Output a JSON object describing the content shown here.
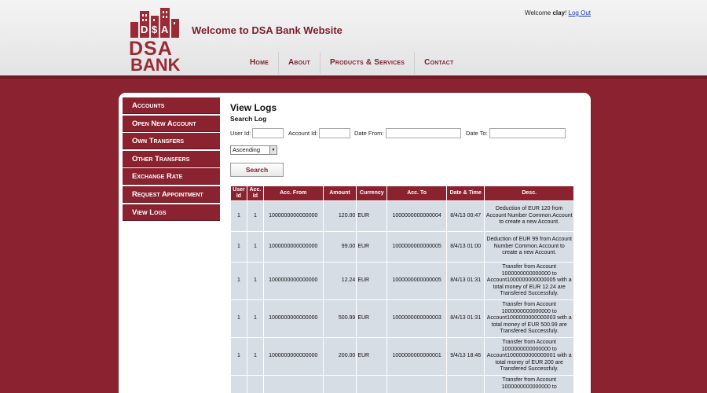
{
  "brand": {
    "logo_top": "DSA",
    "logo_bottom": "BANK",
    "welcome_title": "Welcome to DSA Bank Website",
    "accent_color": "#8b2230"
  },
  "user": {
    "greeting": "Welcome",
    "username": "clay",
    "exclaim": "!",
    "logout_label": "Log Out"
  },
  "topnav": [
    "Home",
    "About",
    "Products & Services",
    "Contact"
  ],
  "sidenav": [
    "Accounts",
    "Open New Account",
    "Own Transfers",
    "Other Transfers",
    "Exchange Rate",
    "Request Appointment",
    "View Logs"
  ],
  "page": {
    "title": "View Logs",
    "subtitle": "Search Log"
  },
  "filters": {
    "user_id_label": "User Id:",
    "account_id_label": "Account Id:",
    "date_from_label": "Date From:",
    "date_to_label": "Date To:",
    "user_id_value": "",
    "account_id_value": "",
    "date_from_value": "",
    "date_to_value": "",
    "sort_selected": "Ascending",
    "search_label": "Search"
  },
  "table": {
    "headers": [
      "User Id",
      "Acc. Id",
      "Acc. From",
      "Amount",
      "Currency",
      "Acc. To",
      "Date & Time",
      "Desc."
    ],
    "rows": [
      [
        "1",
        "1",
        "1000000000000000",
        "120.00",
        "EUR",
        "1000000000000004",
        "8/4/13 00:47",
        "Deduction of EUR 120 from Account Number Common.Account to create a new Account."
      ],
      [
        "1",
        "1",
        "1000000000000000",
        "99.00",
        "EUR",
        "1000000000000005",
        "8/4/13 01:00",
        "Deduction of EUR 99 from Account Number Common.Account to create a new Account."
      ],
      [
        "1",
        "1",
        "1000000000000000",
        "12.24",
        "EUR",
        "1000000000000005",
        "8/4/13 01:31",
        "Transfer from Account 1000000000000000 to Account1000000000000005 with a total money of EUR 12.24 are Transfered Successfuly."
      ],
      [
        "1",
        "1",
        "1000000000000000",
        "500.99",
        "EUR",
        "1000000000000003",
        "8/4/13 01:31",
        "Transfer from Account 1000000000000000 to Account1000000000000003 with a total money of EUR 500.99 are Transfered Successfuly."
      ],
      [
        "1",
        "1",
        "1000000000000000",
        "200.00",
        "EUR",
        "1000000000000001",
        "9/4/13 18:46",
        "Transfer from Account 1000000000000000 to Account1000000000000001 with a total money of EUR 200 are Transfered Successfuly."
      ],
      [
        "",
        "",
        "",
        "",
        "",
        "",
        "",
        "Transfer from Account 1000000000000000 to"
      ]
    ]
  }
}
